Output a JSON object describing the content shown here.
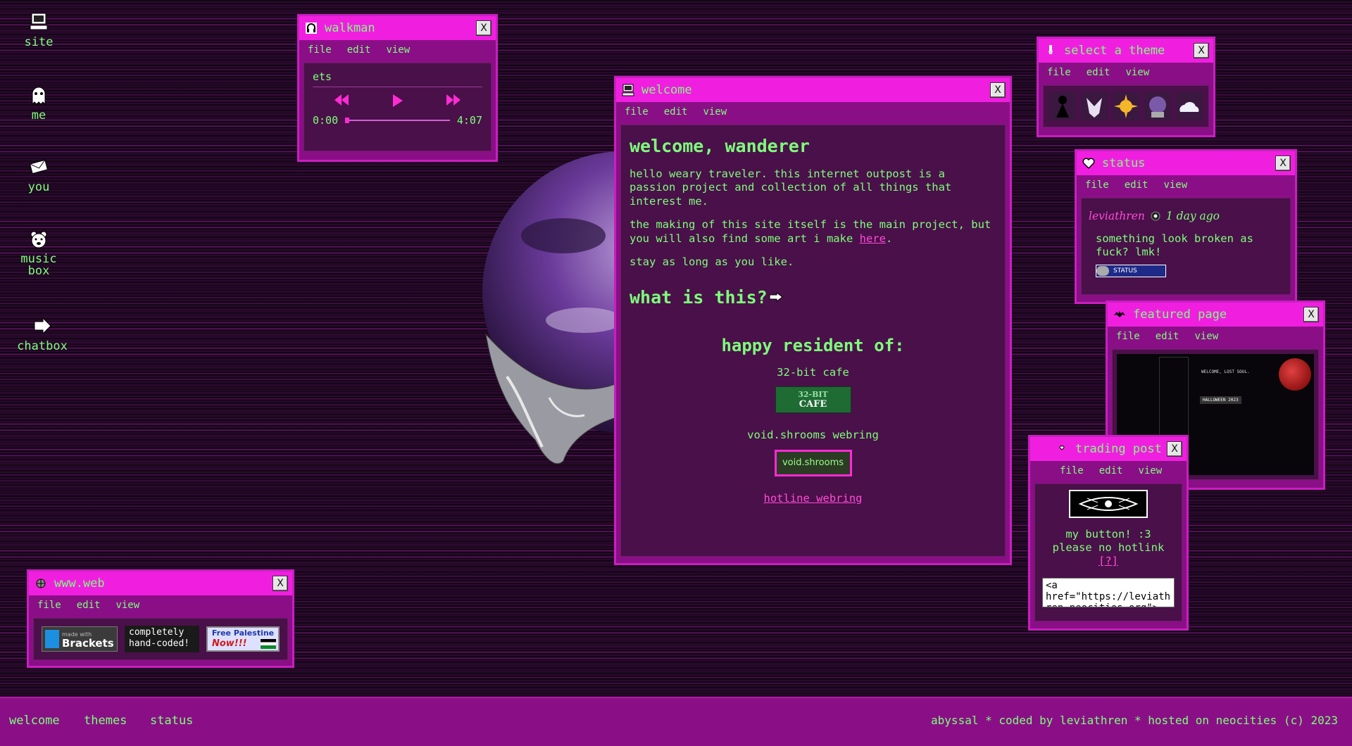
{
  "desktop_icons": [
    {
      "icon": "computer-icon",
      "label": "site"
    },
    {
      "icon": "ghost-icon",
      "label": "me"
    },
    {
      "icon": "envelope-icon",
      "label": "you"
    },
    {
      "icon": "bear-icon",
      "label": "music box"
    },
    {
      "icon": "arrow-icon",
      "label": "chatbox"
    }
  ],
  "menu": {
    "file": "file",
    "edit": "edit",
    "view": "view"
  },
  "close_label": "X",
  "walkman": {
    "title": "walkman",
    "track": "ets",
    "current_time": "0:00",
    "duration": "4:07",
    "progress": 0.0
  },
  "welcome": {
    "title": "welcome",
    "heading": "welcome, wanderer",
    "p1": "hello weary traveler. this internet outpost is a passion project and collection of all things that interest me.",
    "p2_pre": "the making of this site itself is the main project, but you will also find some art i make ",
    "p2_link": "here",
    "p2_post": ".",
    "p3": "stay as long as you like.",
    "what_heading": "what is this?",
    "resident_heading": "happy resident of:",
    "cafe_label": "32-bit cafe",
    "cafe_badge_top": "32-BIT",
    "cafe_badge_bottom": "CAFE",
    "void_label": "void.shrooms webring",
    "void_badge": "void.shrooms",
    "hotline": "hotline webring"
  },
  "theme": {
    "title": "select a theme"
  },
  "status": {
    "title": "status",
    "user": "leviathren",
    "time": "1 day ago",
    "message": "something look broken as fuck? lmk!",
    "badge": "STATUS"
  },
  "featured": {
    "title": "featured page",
    "thumb_heading": "WELCOME, LOST SOUL.",
    "thumb_banner": "HALLOWEEN 2023"
  },
  "trading": {
    "title": "trading post",
    "line1": "my button! :3",
    "line2": "please no hotlink",
    "help": "[?]",
    "code": "<a href=\"https://leviathren.neocities.org\">"
  },
  "wwweb": {
    "title": "www.web",
    "brackets_small": "made with",
    "brackets_big": "Brackets",
    "handcoded": "completely hand-coded!",
    "palestine1": "Free Palestine",
    "palestine2": "Now!!!"
  },
  "taskbar": {
    "welcome": "welcome",
    "themes": "themes",
    "status": "status",
    "credits": "abyssal * coded by leviathren * hosted on neocities (c) 2023"
  },
  "colors": {
    "accent": "#f01fe0",
    "window": "#8a0f86",
    "text": "#7dff7a",
    "link": "#ff4bd8"
  }
}
